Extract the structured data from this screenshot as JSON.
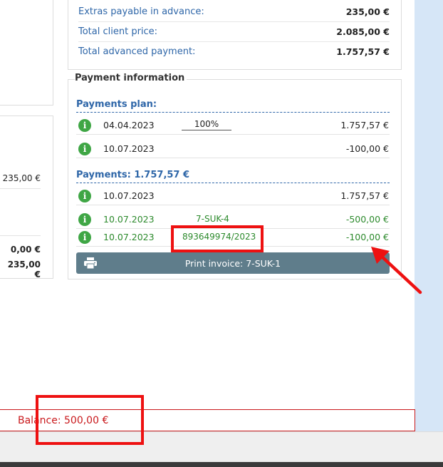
{
  "summary": {
    "rows": [
      {
        "label": "Extras payable in advance:",
        "value": "235,00 €"
      },
      {
        "label": "Total client price:",
        "value": "2.085,00 €"
      },
      {
        "label": "Total advanced payment:",
        "value": "1.757,57 €"
      }
    ]
  },
  "left_panel": {
    "values": [
      "235,00 €",
      "0,00 €",
      "235,00 €"
    ]
  },
  "payment_info": {
    "legend": "Payment information",
    "plan_title": "Payments plan:",
    "plan_rows": [
      {
        "date": "04.04.2023",
        "percent": "100%",
        "amount": "1.757,57 €"
      },
      {
        "date": "10.07.2023",
        "amount": "-100,00 €"
      }
    ],
    "payments_title": "Payments: 1.757,57 €",
    "payment_rows": [
      {
        "date": "10.07.2023",
        "amount": "1.757,57 €"
      },
      {
        "date": "10.07.2023",
        "ref": "7-SUK-4",
        "amount": "-500,00 €"
      },
      {
        "date": "10.07.2023",
        "ref": "893649974/2023",
        "amount": "-100,00 €"
      }
    ],
    "print_button": "Print invoice: 7-SUK-1"
  },
  "balance": {
    "text": "Balance: 500,00 €"
  },
  "icons": {
    "info": "info-icon",
    "print": "printer-icon"
  },
  "colors": {
    "link_blue": "#2e66a8",
    "green": "#2c8a2c",
    "danger_red": "#c9181b",
    "button": "#5f7d8b",
    "annotation": "#ee1111"
  }
}
